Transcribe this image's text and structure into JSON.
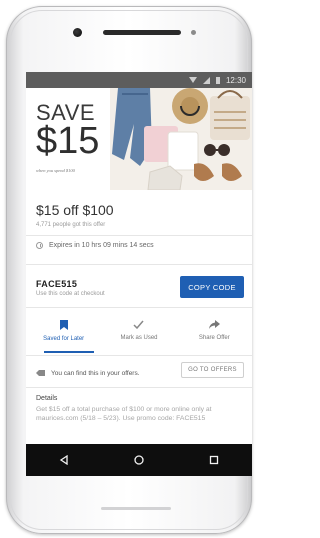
{
  "status_bar": {
    "time": "12:30"
  },
  "hero": {
    "save_label": "SAVE",
    "price": "$15",
    "caption": "when you spend $100"
  },
  "offer": {
    "title": "$15 off $100",
    "count": "4,771 people got this offer",
    "expires": "Expires in 10 hrs 09 mins 14 secs"
  },
  "code": {
    "value": "FACE515",
    "hint": "Use this code at checkout",
    "copy_label": "COPY CODE"
  },
  "actions": [
    {
      "label": "Saved for Later",
      "icon": "bookmark-icon",
      "active": true
    },
    {
      "label": "Mark as Used",
      "icon": "checkmark-icon",
      "active": false
    },
    {
      "label": "Share Offer",
      "icon": "share-icon",
      "active": false
    }
  ],
  "find": {
    "text": "You can find this in your offers.",
    "button_label": "GO TO OFFERS"
  },
  "details": {
    "title": "Details",
    "body": "Get $15 off a total purchase of $100 or more online only at maurices.com (5/18 – 5/23). Use promo code: FACE515"
  },
  "nav": {
    "back_icon": "back-icon",
    "home_icon": "home-icon",
    "recents_icon": "recents-icon"
  },
  "colors": {
    "accent": "#1f5fb3",
    "navbar": "#0e0e0e",
    "status_bar": "#5d5d5d"
  }
}
